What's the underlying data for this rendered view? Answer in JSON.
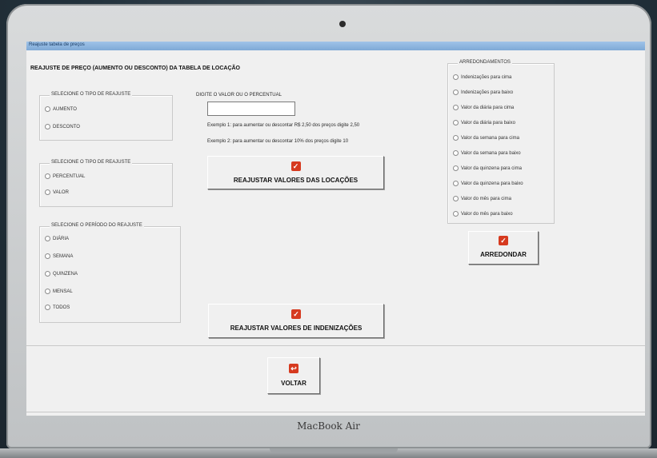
{
  "window": {
    "title": "Reajuste tabela de preços"
  },
  "heading": "REAJUSTE DE PREÇO (AUMENTO OU DESCONTO) DA TABELA DE LOCAÇÃO",
  "tipo_reajuste_1": {
    "legend": "SELECIONE O TIPO DE REAJUSTE",
    "options": [
      "AUMENTO",
      "DESCONTO"
    ]
  },
  "tipo_reajuste_2": {
    "legend": "SELECIONE O TIPO DE REAJUSTE",
    "options": [
      "PERCENTUAL",
      "VALOR"
    ]
  },
  "periodo": {
    "legend": "SELECIONE O PERÍODO DO REAJUSTE",
    "options": [
      "DIÁRIA",
      "SEMANA",
      "QUINZENA",
      "MENSAL",
      "TODOS"
    ]
  },
  "valor": {
    "label": "DIGITE O VALOR OU O PERCENTUAL",
    "value": "",
    "example1": "Exemplo 1: para aumentar ou descontar R$ 2,50 dos preços digite 2,50",
    "example2": "Exemplo 2: para aumentar ou descontar 10% dos preços digite 10"
  },
  "buttons": {
    "reajustar_locacoes": "REAJUSTAR VALORES DAS LOCAÇÕES",
    "reajustar_indenizacoes": "REAJUSTAR VALORES DE INDENIZAÇÕES",
    "arredondar": "ARREDONDAR",
    "voltar": "VOLTAR"
  },
  "arredondamentos": {
    "legend": "ARREDONDAMENTOS",
    "options": [
      "Indenizações para cima",
      "Indenizações para baixo",
      "Valor da diária para cima",
      "Valor da diária para baixo",
      "Valor da semana para cima",
      "Valor da semana para baixo",
      "Valor da quinzena para cima",
      "Valor da quinzena para baixo",
      "Valor do mês para cima",
      "Valor do mês para baixo"
    ]
  },
  "device": {
    "brand": "MacBook Air"
  },
  "colors": {
    "titlebar": "#8fb6df",
    "button_icon": "#d63a1f"
  },
  "icons": {
    "check": "check-icon",
    "back": "back-icon"
  }
}
